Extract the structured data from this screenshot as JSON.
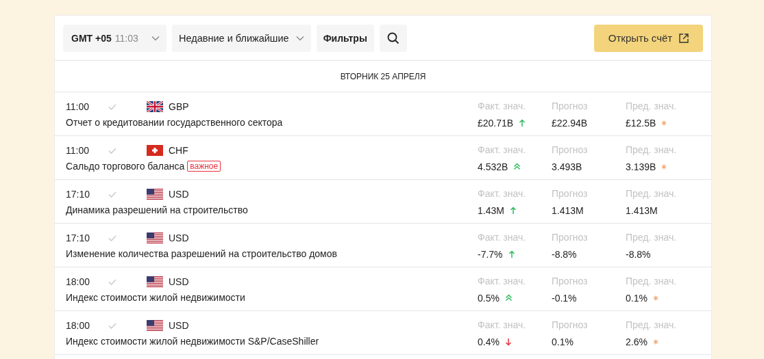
{
  "toolbar": {
    "timezone": "GMT +05",
    "clock": "11:03",
    "sort": "Недавние и ближайшие",
    "filters": "Фильтры",
    "open_account": "Открыть счёт"
  },
  "date_header": "ВТОРНИК 25 АПРЕЛЯ",
  "events": [
    {
      "time": "11:00",
      "flag": {
        "kind": "gb"
      },
      "currency": "GBP",
      "title": "Отчет о кредитовании государственного сектора",
      "actual_label": "Факт. знач.",
      "actual": "£20.71B",
      "trend": {
        "kind": "up"
      },
      "forecast_label": "Прогноз",
      "forecast": "£22.94B",
      "previous_label": "Пред. знач.",
      "previous": "£12.5B",
      "revised": true
    },
    {
      "time": "11:00",
      "flag": {
        "kind": "ch"
      },
      "currency": "CHF",
      "title": "Сальдо торгового баланса",
      "badge": "важное",
      "actual_label": "Факт. знач.",
      "actual": "4.532B",
      "trend": {
        "kind": "strong_up"
      },
      "forecast_label": "Прогноз",
      "forecast": "3.493B",
      "previous_label": "Пред. знач.",
      "previous": "3.139B",
      "revised": true
    },
    {
      "time": "17:10",
      "flag": {
        "kind": "us"
      },
      "currency": "USD",
      "title": "Динамика разрешений на строительство",
      "actual_label": "Факт. знач.",
      "actual": "1.43M",
      "trend": {
        "kind": "up"
      },
      "forecast_label": "Прогноз",
      "forecast": "1.413M",
      "previous_label": "Пред. знач.",
      "previous": "1.413M",
      "revised": false
    },
    {
      "time": "17:10",
      "flag": {
        "kind": "us"
      },
      "currency": "USD",
      "title": "Изменение количества разрешений на строительство домов",
      "actual_label": "Факт. знач.",
      "actual": "-7.7%",
      "trend": {
        "kind": "up"
      },
      "forecast_label": "Прогноз",
      "forecast": "-8.8%",
      "previous_label": "Пред. знач.",
      "previous": "-8.8%",
      "revised": false
    },
    {
      "time": "18:00",
      "flag": {
        "kind": "us"
      },
      "currency": "USD",
      "title": "Индекс стоимости жилой недвижимости",
      "actual_label": "Факт. знач.",
      "actual": "0.5%",
      "trend": {
        "kind": "strong_up"
      },
      "forecast_label": "Прогноз",
      "forecast": "-0.1%",
      "previous_label": "Пред. знач.",
      "previous": "0.1%",
      "revised": true
    },
    {
      "time": "18:00",
      "flag": {
        "kind": "us"
      },
      "currency": "USD",
      "title": "Индекс стоимости жилой недвижимости S&P/CaseShiller",
      "actual_label": "Факт. знач.",
      "actual": "0.4%",
      "trend": {
        "kind": "down"
      },
      "forecast_label": "Прогноз",
      "forecast": "0.1%",
      "previous_label": "Пред. знач.",
      "previous": "2.6%",
      "revised": true
    }
  ]
}
